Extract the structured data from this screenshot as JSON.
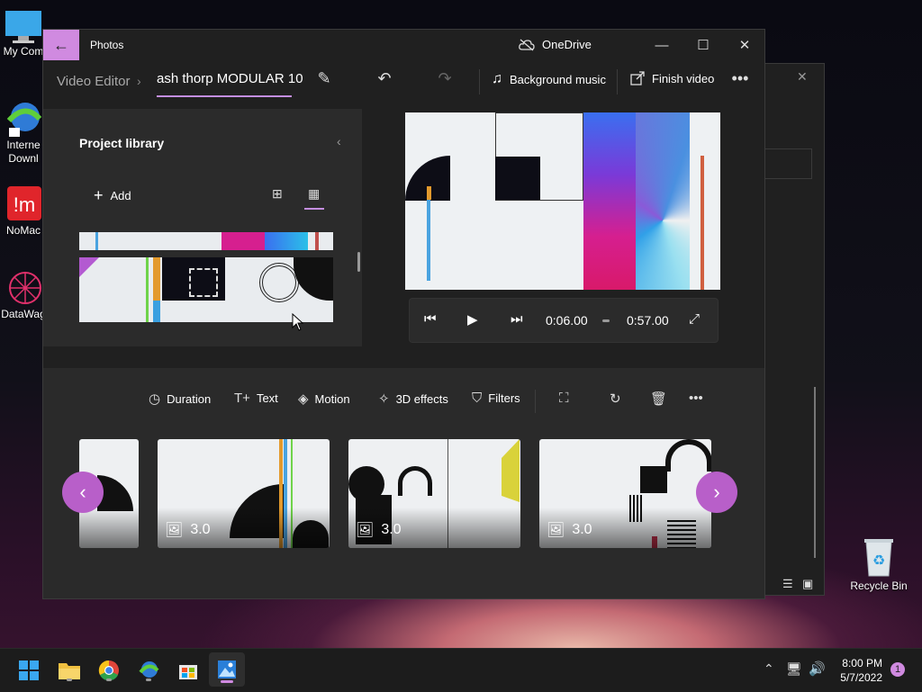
{
  "desktop": {
    "icons": [
      {
        "label": "My Com",
        "icon": "computer-icon"
      },
      {
        "label": "Interne Downl",
        "icon": "download-manager-icon"
      },
      {
        "label": "NoMac",
        "icon": "nomacs-icon"
      },
      {
        "label": "DataWag",
        "icon": "datawag-icon"
      }
    ],
    "recycle_bin": "Recycle Bin"
  },
  "window": {
    "app_title": "Photos",
    "onedrive_label": "OneDrive",
    "breadcrumb_root": "Video Editor",
    "project_name": "ash thorp MODULAR 10",
    "background_music": "Background music",
    "finish_video": "Finish video"
  },
  "library": {
    "title": "Project library",
    "add_label": "Add"
  },
  "player": {
    "current_time": "0:06.00",
    "total_time": "0:57.00"
  },
  "storyboard": {
    "tools": [
      {
        "label": "Duration",
        "icon": "clock-icon"
      },
      {
        "label": "Text",
        "icon": "text-icon"
      },
      {
        "label": "Motion",
        "icon": "motion-icon"
      },
      {
        "label": "3D effects",
        "icon": "3d-effects-icon"
      },
      {
        "label": "Filters",
        "icon": "filters-icon"
      }
    ],
    "clips": [
      {
        "duration": "3.0"
      },
      {
        "duration": "3.0"
      },
      {
        "duration": "3.0"
      }
    ]
  },
  "taskbar": {
    "time": "8:00 PM",
    "date": "5/7/2022",
    "notifications": "1"
  },
  "colors": {
    "accent": "#d08ae0",
    "nav_button": "#b85fc9",
    "window_bg": "#202020",
    "panel_bg": "#2b2b2b"
  }
}
